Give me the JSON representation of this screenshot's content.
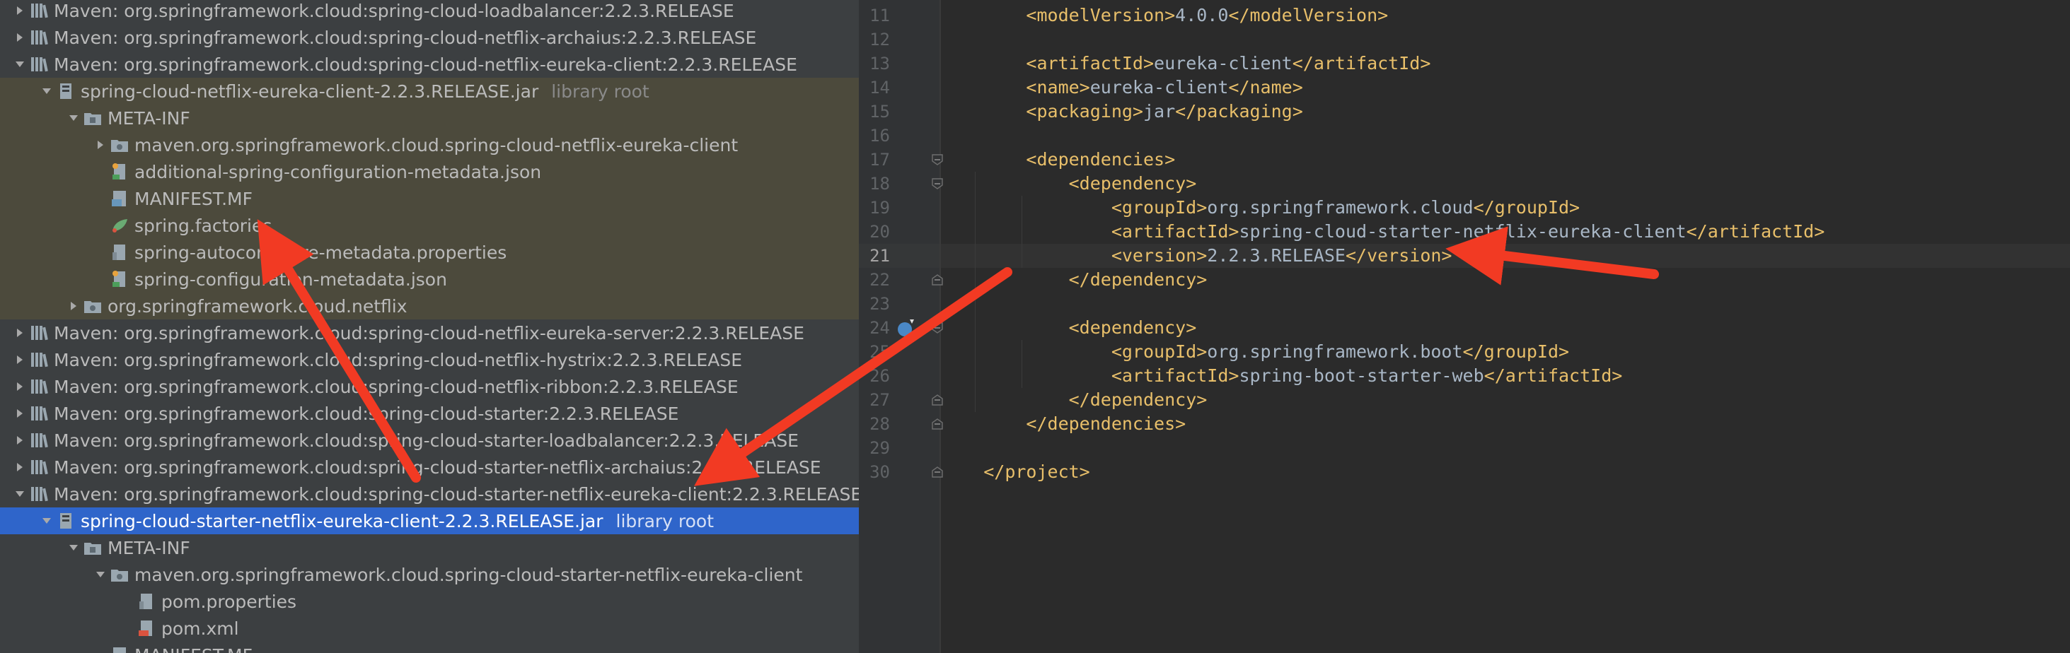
{
  "tree": {
    "rows": [
      {
        "indent": 0,
        "arrow": "right",
        "icon": "library",
        "label": "Maven: org.springframework.cloud:spring-cloud-loadbalancer:2.2.3.RELEASE",
        "note": "",
        "state": ""
      },
      {
        "indent": 0,
        "arrow": "right",
        "icon": "library",
        "label": "Maven: org.springframework.cloud:spring-cloud-netflix-archaius:2.2.3.RELEASE",
        "note": "",
        "state": ""
      },
      {
        "indent": 0,
        "arrow": "down",
        "icon": "library",
        "label": "Maven: org.springframework.cloud:spring-cloud-netflix-eureka-client:2.2.3.RELEASE",
        "note": "",
        "state": ""
      },
      {
        "indent": 1,
        "arrow": "down",
        "icon": "jar",
        "label": "spring-cloud-netflix-eureka-client-2.2.3.RELEASE.jar",
        "note": "library root",
        "state": "hl"
      },
      {
        "indent": 2,
        "arrow": "down",
        "icon": "folder",
        "label": "META-INF",
        "note": "",
        "state": "hl"
      },
      {
        "indent": 3,
        "arrow": "right",
        "icon": "package",
        "label": "maven.org.springframework.cloud.spring-cloud-netflix-eureka-client",
        "note": "",
        "state": "hl"
      },
      {
        "indent": 3,
        "arrow": "",
        "icon": "json",
        "label": "additional-spring-configuration-metadata.json",
        "note": "",
        "state": "hl"
      },
      {
        "indent": 3,
        "arrow": "",
        "icon": "manifest",
        "label": "MANIFEST.MF",
        "note": "",
        "state": "hl"
      },
      {
        "indent": 3,
        "arrow": "",
        "icon": "spring",
        "label": "spring.factories",
        "note": "",
        "state": "hl"
      },
      {
        "indent": 3,
        "arrow": "",
        "icon": "properties",
        "label": "spring-autoconfigure-metadata.properties",
        "note": "",
        "state": "hl"
      },
      {
        "indent": 3,
        "arrow": "",
        "icon": "json",
        "label": "spring-configuration-metadata.json",
        "note": "",
        "state": "hl"
      },
      {
        "indent": 2,
        "arrow": "right",
        "icon": "package",
        "label": "org.springframework.cloud.netflix",
        "note": "",
        "state": "hl"
      },
      {
        "indent": 0,
        "arrow": "right",
        "icon": "library",
        "label": "Maven: org.springframework.cloud:spring-cloud-netflix-eureka-server:2.2.3.RELEASE",
        "note": "",
        "state": ""
      },
      {
        "indent": 0,
        "arrow": "right",
        "icon": "library",
        "label": "Maven: org.springframework.cloud:spring-cloud-netflix-hystrix:2.2.3.RELEASE",
        "note": "",
        "state": ""
      },
      {
        "indent": 0,
        "arrow": "right",
        "icon": "library",
        "label": "Maven: org.springframework.cloud:spring-cloud-netflix-ribbon:2.2.3.RELEASE",
        "note": "",
        "state": ""
      },
      {
        "indent": 0,
        "arrow": "right",
        "icon": "library",
        "label": "Maven: org.springframework.cloud:spring-cloud-starter:2.2.3.RELEASE",
        "note": "",
        "state": ""
      },
      {
        "indent": 0,
        "arrow": "right",
        "icon": "library",
        "label": "Maven: org.springframework.cloud:spring-cloud-starter-loadbalancer:2.2.3.RELEASE",
        "note": "",
        "state": ""
      },
      {
        "indent": 0,
        "arrow": "right",
        "icon": "library",
        "label": "Maven: org.springframework.cloud:spring-cloud-starter-netflix-archaius:2.2.3.RELEASE",
        "note": "",
        "state": ""
      },
      {
        "indent": 0,
        "arrow": "down",
        "icon": "library",
        "label": "Maven: org.springframework.cloud:spring-cloud-starter-netflix-eureka-client:2.2.3.RELEASE",
        "note": "",
        "state": ""
      },
      {
        "indent": 1,
        "arrow": "down",
        "icon": "jar",
        "label": "spring-cloud-starter-netflix-eureka-client-2.2.3.RELEASE.jar",
        "note": "library root",
        "state": "sel"
      },
      {
        "indent": 2,
        "arrow": "down",
        "icon": "folder",
        "label": "META-INF",
        "note": "",
        "state": ""
      },
      {
        "indent": 3,
        "arrow": "down",
        "icon": "package",
        "label": "maven.org.springframework.cloud.spring-cloud-starter-netflix-eureka-client",
        "note": "",
        "state": ""
      },
      {
        "indent": 4,
        "arrow": "",
        "icon": "properties",
        "label": "pom.properties",
        "note": "",
        "state": ""
      },
      {
        "indent": 4,
        "arrow": "",
        "icon": "xml",
        "label": "pom.xml",
        "note": "",
        "state": ""
      },
      {
        "indent": 3,
        "arrow": "",
        "icon": "manifest",
        "label": "MANIFEST.MF",
        "note": "",
        "state": ""
      }
    ]
  },
  "editor": {
    "lines": [
      {
        "n": "11",
        "tokens": [
          [
            "t",
            "        "
          ],
          [
            "b",
            "<modelVersion>"
          ],
          [
            "t",
            "4.0.0"
          ],
          [
            "b",
            "</modelVersion>"
          ]
        ],
        "fold": "",
        "cur": false
      },
      {
        "n": "12",
        "tokens": [],
        "fold": "",
        "cur": false
      },
      {
        "n": "13",
        "tokens": [
          [
            "t",
            "        "
          ],
          [
            "b",
            "<artifactId>"
          ],
          [
            "t",
            "eureka-client"
          ],
          [
            "b",
            "</artifactId>"
          ]
        ],
        "fold": "",
        "cur": false
      },
      {
        "n": "14",
        "tokens": [
          [
            "t",
            "        "
          ],
          [
            "b",
            "<name>"
          ],
          [
            "t",
            "eureka-client"
          ],
          [
            "b",
            "</name>"
          ]
        ],
        "fold": "",
        "cur": false
      },
      {
        "n": "15",
        "tokens": [
          [
            "t",
            "        "
          ],
          [
            "b",
            "<packaging>"
          ],
          [
            "t",
            "jar"
          ],
          [
            "b",
            "</packaging>"
          ]
        ],
        "fold": "",
        "cur": false
      },
      {
        "n": "16",
        "tokens": [],
        "fold": "",
        "cur": false
      },
      {
        "n": "17",
        "tokens": [
          [
            "t",
            "        "
          ],
          [
            "b",
            "<dependencies>"
          ]
        ],
        "fold": "open",
        "cur": false
      },
      {
        "n": "18",
        "tokens": [
          [
            "t",
            "            "
          ],
          [
            "b",
            "<dependency>"
          ]
        ],
        "fold": "open",
        "cur": false
      },
      {
        "n": "19",
        "tokens": [
          [
            "t",
            "                "
          ],
          [
            "b",
            "<groupId>"
          ],
          [
            "t",
            "org.springframework.cloud"
          ],
          [
            "b",
            "</groupId>"
          ]
        ],
        "fold": "",
        "cur": false
      },
      {
        "n": "20",
        "tokens": [
          [
            "t",
            "                "
          ],
          [
            "b",
            "<artifactId>"
          ],
          [
            "t",
            "spring-cloud-starter-netflix-eureka-client"
          ],
          [
            "b",
            "</artifactId>"
          ]
        ],
        "fold": "",
        "cur": false
      },
      {
        "n": "21",
        "tokens": [
          [
            "t",
            "                "
          ],
          [
            "b",
            "<version>"
          ],
          [
            "t",
            "2.2.3.RELEASE"
          ],
          [
            "b",
            "</version>"
          ]
        ],
        "fold": "",
        "cur": true
      },
      {
        "n": "22",
        "tokens": [
          [
            "t",
            "            "
          ],
          [
            "b",
            "</dependency>"
          ]
        ],
        "fold": "close",
        "cur": false
      },
      {
        "n": "23",
        "tokens": [],
        "fold": "",
        "cur": false
      },
      {
        "n": "24",
        "tokens": [
          [
            "t",
            "            "
          ],
          [
            "b",
            "<dependency>"
          ]
        ],
        "fold": "open",
        "cur": false
      },
      {
        "n": "25",
        "tokens": [
          [
            "t",
            "                "
          ],
          [
            "b",
            "<groupId>"
          ],
          [
            "t",
            "org.springframework.boot"
          ],
          [
            "b",
            "</groupId>"
          ]
        ],
        "fold": "",
        "cur": false
      },
      {
        "n": "26",
        "tokens": [
          [
            "t",
            "                "
          ],
          [
            "b",
            "<artifactId>"
          ],
          [
            "t",
            "spring-boot-starter-web"
          ],
          [
            "b",
            "</artifactId>"
          ]
        ],
        "fold": "",
        "cur": false
      },
      {
        "n": "27",
        "tokens": [
          [
            "t",
            "            "
          ],
          [
            "b",
            "</dependency>"
          ]
        ],
        "fold": "close",
        "cur": false
      },
      {
        "n": "28",
        "tokens": [
          [
            "t",
            "        "
          ],
          [
            "b",
            "</dependencies>"
          ]
        ],
        "fold": "close",
        "cur": false
      },
      {
        "n": "29",
        "tokens": [],
        "fold": "",
        "cur": false
      },
      {
        "n": "30",
        "tokens": [
          [
            "t",
            "    "
          ],
          [
            "b",
            "</project>"
          ]
        ],
        "fold": "close",
        "cur": false
      }
    ]
  },
  "colors": {
    "tree_bg": "#3c3f41",
    "tree_highlight": "#4c4a3c",
    "selection": "#2f65ca",
    "editor_bg": "#2b2b2b",
    "xml_tag": "#e8bf6a",
    "text": "#a9b7c6",
    "annotation_arrow": "#f23a23"
  }
}
